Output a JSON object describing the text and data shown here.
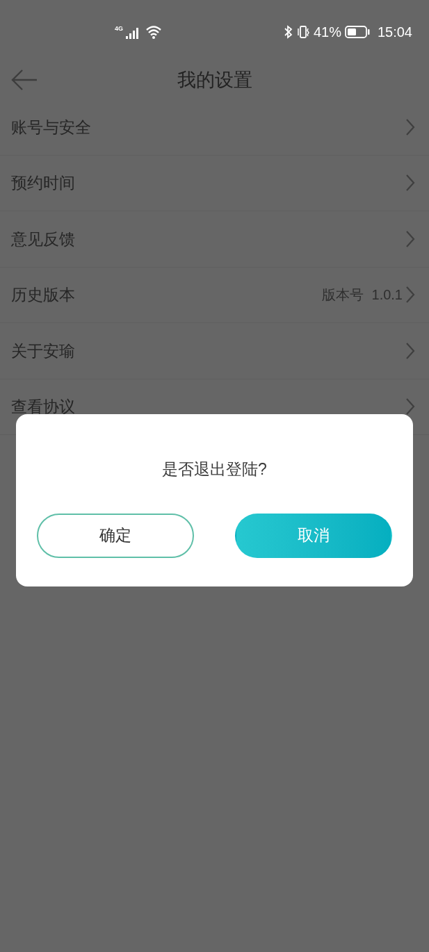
{
  "status_bar": {
    "network": "4G",
    "battery": "41%",
    "time": "15:04"
  },
  "header": {
    "title": "我的设置"
  },
  "settings": [
    {
      "label": "账号与安全"
    },
    {
      "label": "预约时间"
    },
    {
      "label": "意见反馈"
    },
    {
      "label": "历史版本",
      "value": "版本号  1.0.1"
    },
    {
      "label": "关于安瑜"
    },
    {
      "label": "查看协议"
    }
  ],
  "dialog": {
    "message": "是否退出登陆?",
    "buttons": [
      {
        "label": "确定",
        "kind": "outline"
      },
      {
        "label": "取消",
        "kind": "filled"
      }
    ]
  }
}
